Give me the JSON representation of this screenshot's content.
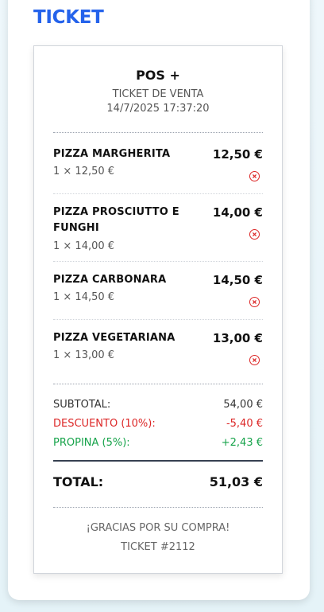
{
  "section_title": "TICKET",
  "ticket": {
    "store_name": "POS +",
    "type": "TICKET DE VENTA",
    "datetime": "14/7/2025 17:37:20",
    "items": [
      {
        "name": "PIZZA MARGHERITA",
        "qty_line": "1 × 12,50 €",
        "price": "12,50 €"
      },
      {
        "name": "PIZZA PROSCIUTTO E FUNGHI",
        "qty_line": "1 × 14,00 €",
        "price": "14,00 €"
      },
      {
        "name": "PIZZA CARBONARA",
        "qty_line": "1 × 14,50 €",
        "price": "14,50 €"
      },
      {
        "name": "PIZZA VEGETARIANA",
        "qty_line": "1 × 13,00 €",
        "price": "13,00 €"
      }
    ],
    "subtotal": {
      "label": "SUBTOTAL:",
      "value": "54,00 €"
    },
    "discount": {
      "label": "DESCUENTO (10%):",
      "value": "-5,40 €"
    },
    "tip": {
      "label": "PROPINA (5%):",
      "value": "+2,43 €"
    },
    "total": {
      "label": "TOTAL:",
      "value": "51,03 €"
    },
    "thanks": "¡GRACIAS POR SU COMPRA!",
    "ticket_number": "TICKET #2112"
  },
  "colors": {
    "accent": "#2563eb",
    "remove": "#dc2626",
    "discount": "#dc2626",
    "tip": "#16a34a"
  },
  "icons": {
    "remove": "circle-x-icon"
  }
}
